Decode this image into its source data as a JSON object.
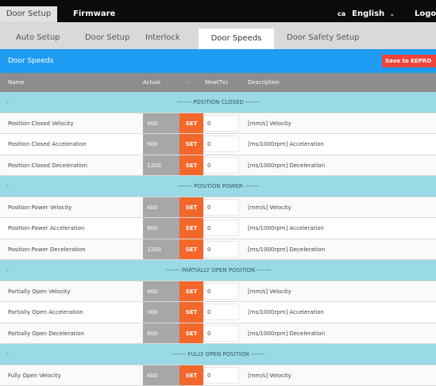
{
  "topbar": {
    "door_setup": "Door Setup",
    "firmware": "Firmware",
    "lang_code": "ca",
    "language": "English",
    "chevron": "⌄",
    "logout": "Logo"
  },
  "subtabs": [
    {
      "label": "Auto Setup",
      "active": false
    },
    {
      "label": "Door Setup",
      "active": false
    },
    {
      "label": "Interlock",
      "active": false
    },
    {
      "label": "Door Speeds",
      "active": true
    },
    {
      "label": "Door Safety Setup",
      "active": false
    }
  ],
  "section": {
    "title": "Door Speeds",
    "save_label": "Save to EEPRO"
  },
  "columns": {
    "name": "Name",
    "actual": "Actual",
    "dash": "-",
    "new": "New(Tx)",
    "description": "Description"
  },
  "colors": {
    "accent_blue": "#1e9cf3",
    "set_orange": "#f4672a",
    "save_red": "#f0433b",
    "section_teal": "#9ad9e6"
  },
  "rows": [
    {
      "type": "section",
      "dash": "-",
      "title": "------- POSITION CLOSED -------"
    },
    {
      "type": "param",
      "name": "Position Closed Velocity",
      "actual": "400",
      "set": "SET",
      "new": "0",
      "desc": "[mm/s] Velocity"
    },
    {
      "type": "param",
      "name": "Position Closed Acceleration",
      "actual": "900",
      "set": "SET",
      "new": "0",
      "desc": "[ms/1000rpm] Acceleration"
    },
    {
      "type": "param",
      "name": "Position Closed Deceleration",
      "actual": "1200",
      "set": "SET",
      "new": "0",
      "desc": "[ms/1000rpm] Deceleration"
    },
    {
      "type": "section",
      "dash": "-",
      "title": "------- POSITION POWER -------"
    },
    {
      "type": "param",
      "name": "Position Power Velocity",
      "actual": "400",
      "set": "SET",
      "new": "0",
      "desc": "[mm/s] Velocity"
    },
    {
      "type": "param",
      "name": "Position Power Acceleration",
      "actual": "900",
      "set": "SET",
      "new": "0",
      "desc": "[ms/1000rpm] Acceleration"
    },
    {
      "type": "param",
      "name": "Position Power Deceleration",
      "actual": "1200",
      "set": "SET",
      "new": "0",
      "desc": "[ms/1000rpm] Deceleration"
    },
    {
      "type": "section",
      "dash": "-",
      "title": "------- PARTIALLY OPEN POSITION -------"
    },
    {
      "type": "param",
      "name": "Partially Open Velocity",
      "actual": "400",
      "set": "SET",
      "new": "0",
      "desc": "[mm/s] Velocity"
    },
    {
      "type": "param",
      "name": "Partially Open Acceleration",
      "actual": "300",
      "set": "SET",
      "new": "0",
      "desc": "[ms/1000rpm] Acceleration"
    },
    {
      "type": "param",
      "name": "Partially Open Deceleration",
      "actual": "900",
      "set": "SET",
      "new": "0",
      "desc": "[ms/1000rpm] Deceleration"
    },
    {
      "type": "section",
      "dash": "-",
      "title": "------- FULLY OPEN POSITION -------"
    },
    {
      "type": "param",
      "name": "Fully Open Velocity",
      "actual": "400",
      "set": "SET",
      "new": "0",
      "desc": "[mm/s] Velocity"
    }
  ]
}
